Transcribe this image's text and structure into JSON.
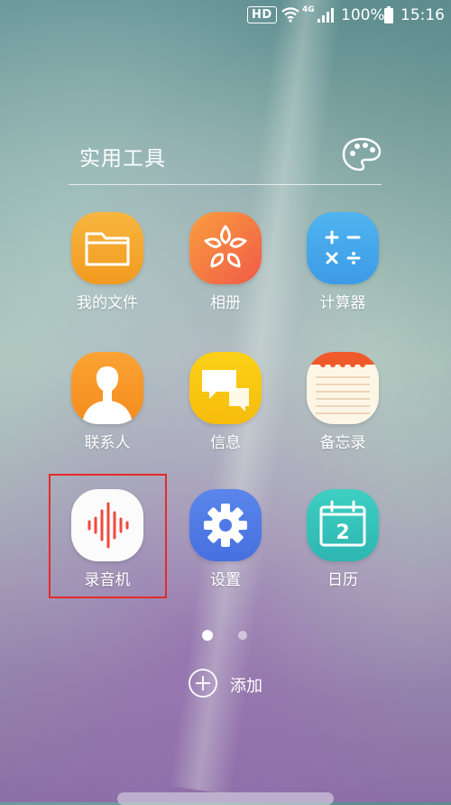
{
  "status_bar": {
    "hd": "HD",
    "network": "4G",
    "battery": "100%",
    "time": "15:16",
    "icons": [
      "wifi-icon",
      "signal-icon",
      "battery-icon"
    ]
  },
  "folder": {
    "title": "实用工具",
    "theme_icon": "palette-icon"
  },
  "apps": [
    {
      "label": "我的文件",
      "icon": "folder-icon"
    },
    {
      "label": "相册",
      "icon": "flower-icon"
    },
    {
      "label": "计算器",
      "icon": "calculator-icon"
    },
    {
      "label": "联系人",
      "icon": "person-icon"
    },
    {
      "label": "信息",
      "icon": "chat-bubbles-icon"
    },
    {
      "label": "备忘录",
      "icon": "notepad-icon"
    },
    {
      "label": "录音机",
      "icon": "waveform-icon"
    },
    {
      "label": "设置",
      "icon": "gear-icon"
    },
    {
      "label": "日历",
      "icon": "calendar-icon",
      "date": "2"
    }
  ],
  "highlighted_app": "录音机",
  "pager": {
    "current": 1,
    "total": 2
  },
  "add": {
    "label": "添加"
  },
  "colors": {
    "highlight": "#e52a2a"
  }
}
